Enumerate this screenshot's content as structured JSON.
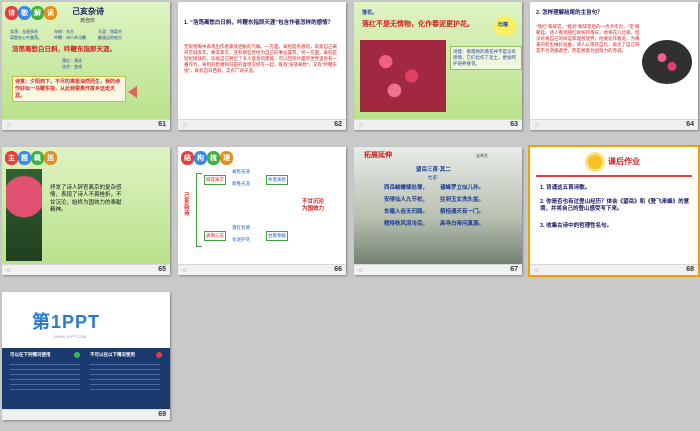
{
  "slides": [
    {
      "num": "61",
      "tags": [
        "诗",
        "歌",
        "解",
        "读"
      ],
      "title": "己亥杂诗",
      "author": "龚自珍",
      "notes": [
        "浩荡：无限多的",
        "离愁在心中激荡。",
        "东指：东方",
        "吟鞭：诗人的马鞭",
        "天涯：指离京",
        "都遥远的地方"
      ],
      "lines": [
        "浩荡离愁白日斜，吟鞭东指即天涯。"
      ],
      "sub": [
        "落红：落花",
        "化作：变成"
      ],
      "summary": "诗意：夕阳西下，不尽的离愁油然而生，我的诗作好似一马鞭东指，从此我要离开故乡远走天涯。"
    },
    {
      "num": "62",
      "q": "1. “浩荡离愁白日斜，吟鞭东指即天涯”包含作者怎样的感情？",
      "a": "无限感慨中表现出作者豪放洒脱的气概。一方面，离别是伤感的，毕竟自己离开京城多年，故友挚交，还有那些曾经为自己的事业操劳，另一方面，离别是轻松愉快的，毕竟自己跳出了令人窒息的樊笼，可以回到外面的世界里另有一番作为。离别的愁绪和归田的喜悦交织在一起，既有“浩荡离愁”，又有“吟鞭东指”，既有自日西斜，又有广阔天涯。"
    },
    {
      "num": "63",
      "label": "落花。",
      "line": "落红不是无情物，化作春泥更护花。",
      "bubble": "比喻",
      "shiyi": "诗意：那落地的落花并不是没有感情，它们化作了泥土，更加呵护培养春花。"
    },
    {
      "num": "64",
      "q": "2. 怎样理解结尾的主旨句？",
      "a": "“落红”喻辞官，“春泥”喻辞官后的一点点作为，“花”喻朝廷。诗人看到随红缤纷的落日，他将花儿比喻，但没有将自己的命运和理想放弃，他要化作春泥，为将来的新生做好准备，诗人以落花自比，表达了自己辞官不为消极避世，而是想着为国效力的赤诚。"
    },
    {
      "num": "65",
      "tags": [
        "主",
        "题",
        "概",
        "括"
      ],
      "text": "抒发了诗人辞官离京的复杂感情，表现了诗人不畏挫折，不甘沉沦，始终为国效力的奉献精神。"
    },
    {
      "num": "66",
      "tags": [
        "结",
        "构",
        "梳",
        "理"
      ],
      "title": "己亥杂诗",
      "nodes": [
        "辞官离京",
        "离愁浩荡",
        "新胜天涯",
        "表明心志",
        "落红有情",
        "化泥护花"
      ],
      "themes": [
        "失意离愁",
        "甘愿奉献"
      ],
      "center": "不甘沉沦\n为国效力"
    },
    {
      "num": "67",
      "title": "拓展延伸",
      "subtitle": "望岳三首·其二",
      "author": "杜甫",
      "poem": [
        "西岳峻嶒竦处尊，",
        "诸峰罗立似儿孙。",
        "安得仙人九节杖，",
        "拄到玉女洗头盆。",
        "车箱入谷无归路，",
        "箭栝通天有一门。",
        "稍待秋风凉冷后，",
        "高寻白帝问真源。"
      ],
      "credit": "宝鸡艺"
    },
    {
      "num": "68",
      "title": "课后作业",
      "items": [
        "1. 背诵这五首诗歌。",
        "2. 你是否也有过登山经历？体会《望岳》和《登飞来峰》的意境，并将自己的登山感受写下来。",
        "3. 收集古诗中的哲理性名句。"
      ]
    },
    {
      "num": "69",
      "logo": "第1PPT",
      "logo_sub": "WWW.1PPT.COM",
      "left_title": "可以在下列情况使用",
      "right_title": "不可以在以下情况使用"
    }
  ]
}
